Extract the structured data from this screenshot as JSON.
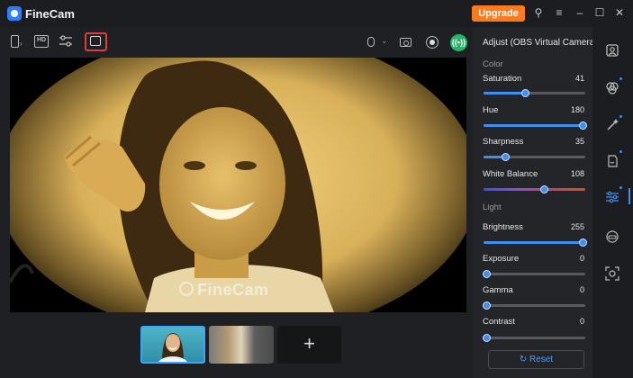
{
  "app": {
    "title": "FineCam",
    "upgrade_label": "Upgrade"
  },
  "titlebar": {
    "icons": [
      "pin-icon",
      "menu-icon",
      "minimize-icon",
      "maximize-icon",
      "close-icon"
    ]
  },
  "toolbar": {
    "left_icons": [
      "sidebar-toggle-icon",
      "hd-icon",
      "sliders-icon",
      "note-icon"
    ],
    "hd_label": "HD",
    "right_icons": [
      "microphone-icon",
      "chevron-down-icon",
      "camera-icon",
      "record-icon",
      "live-icon"
    ]
  },
  "preview": {
    "watermark": "FineCam"
  },
  "thumbnails": {
    "add_label": "+"
  },
  "panel": {
    "title": "Adjust (OBS Virtual Camera)",
    "color_section": "Color",
    "light_section": "Light",
    "sliders": [
      {
        "label": "Saturation",
        "value": "41",
        "fraction": 0.41
      },
      {
        "label": "Hue",
        "value": "180",
        "fraction": 1.0
      },
      {
        "label": "Sharpness",
        "value": "35",
        "fraction": 0.2
      },
      {
        "label": "White Balance",
        "value": "108",
        "fraction": 0.6
      },
      {
        "label": "Brightness",
        "value": "255",
        "fraction": 1.0
      },
      {
        "label": "Exposure",
        "value": "0",
        "fraction": 0.0
      },
      {
        "label": "Gamma",
        "value": "0",
        "fraction": 0.0
      },
      {
        "label": "Contrast",
        "value": "0",
        "fraction": 0.0
      }
    ],
    "reset_label": "Reset"
  },
  "rail": {
    "icons": [
      "portrait-icon",
      "filter-icon",
      "magic-wand-icon",
      "sticker-icon",
      "adjust-icon",
      "virtual-avatar-icon",
      "face-scan-icon"
    ]
  },
  "colors": {
    "accent": "#3f8ef0",
    "upgrade": "#ff7a1a",
    "live": "#27b36a",
    "highlight": "#e03a3a"
  }
}
